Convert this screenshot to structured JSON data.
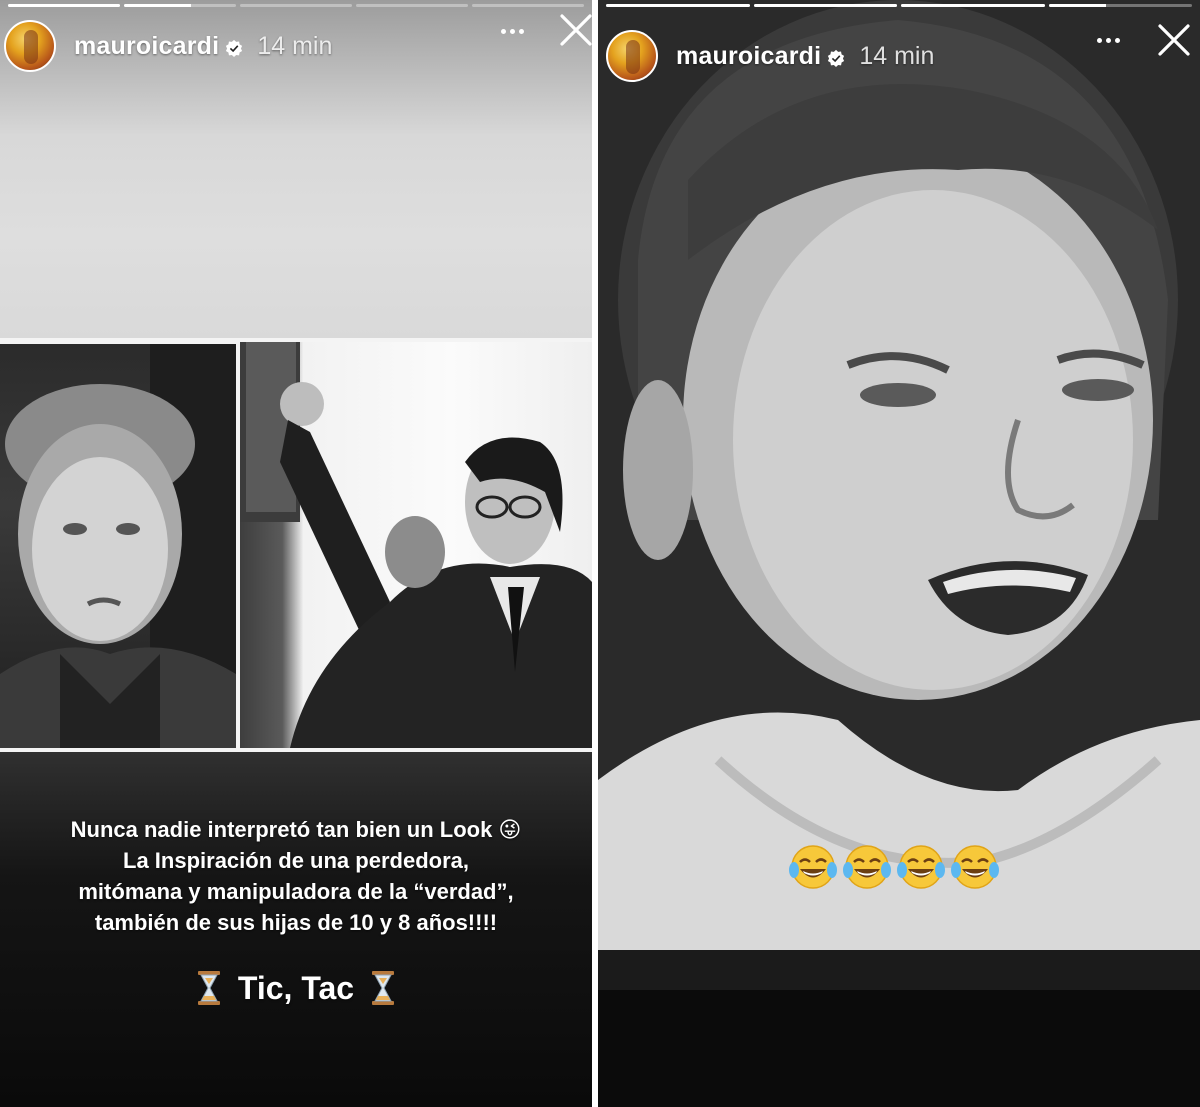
{
  "colors": {
    "background": "#0c0c0c",
    "text": "#ffffff",
    "progress_track": "rgba(255,255,255,0.35)"
  },
  "stories": [
    {
      "progress": [
        1,
        0.6,
        0,
        0,
        0
      ],
      "username": "mauroicardi",
      "time": "14 min",
      "icons": [
        "verified-icon",
        "more-icon",
        "close-icon",
        "hourglass-icon"
      ],
      "caption_lines": [
        "Nunca nadie interpretó tan bien un Look 😜",
        "La Inspiración de una perdedora,",
        "mitómana y manipuladora de la “verdad”,",
        "también de sus hijas de 10 y 8 años!!!!"
      ],
      "tic_tac": "Tic, Tac"
    },
    {
      "progress": [
        1,
        1,
        1,
        0.4
      ],
      "username": "mauroicardi",
      "time": "14 min",
      "icons": [
        "verified-icon",
        "more-icon",
        "close-icon",
        "tears-of-joy-emoji"
      ],
      "emoji_count": 4
    }
  ]
}
